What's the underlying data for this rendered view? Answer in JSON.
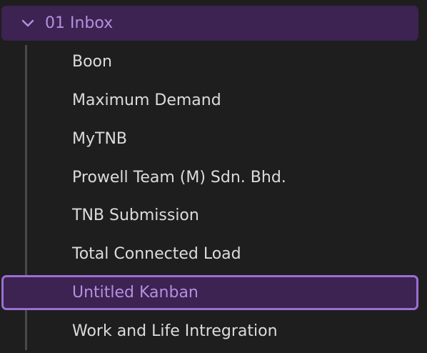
{
  "colors": {
    "background": "#1e1e1e",
    "selected_bg": "#3c2351",
    "selected_border": "#9b6fd4",
    "accent_text": "#b58fe0",
    "item_text": "#dcdcdc",
    "guide": "#4a4a4a"
  },
  "folder": {
    "icon": "chevron-down-icon",
    "label": "01 Inbox",
    "expanded": true
  },
  "items": [
    {
      "label": "Boon"
    },
    {
      "label": "Maximum Demand"
    },
    {
      "label": "MyTNB"
    },
    {
      "label": "Prowell Team (M) Sdn. Bhd."
    },
    {
      "label": "TNB Submission"
    },
    {
      "label": "Total Connected Load"
    },
    {
      "label": "Untitled Kanban",
      "selected": true
    },
    {
      "label": "Work and Life Intregration"
    }
  ]
}
